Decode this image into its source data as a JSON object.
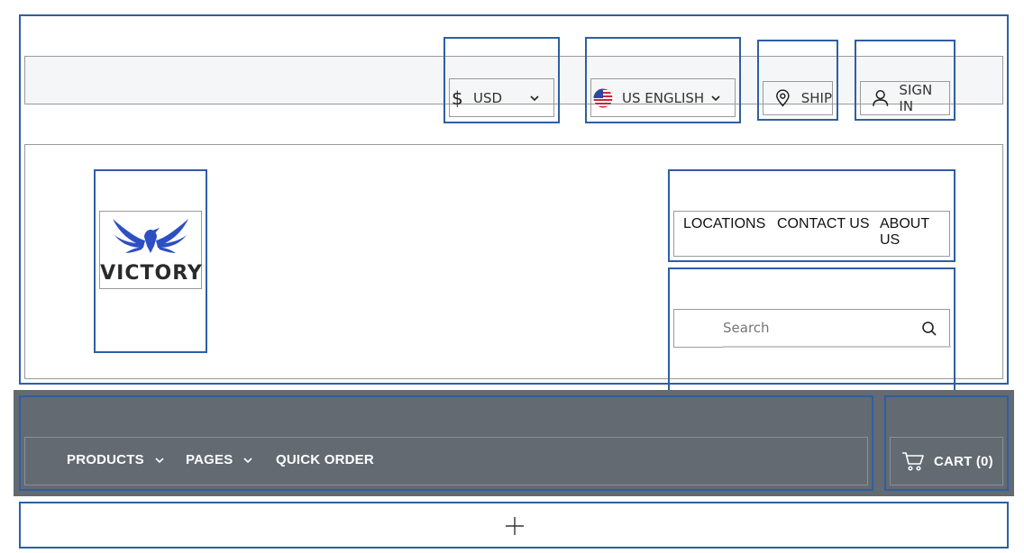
{
  "header": {
    "utility_bar": {
      "currency": {
        "symbol": "$",
        "label": "USD",
        "icon": "chevron-down-icon"
      },
      "language": {
        "label": "US ENGLISH",
        "flag_icon": "us-flag-icon",
        "icon": "chevron-down-icon"
      },
      "ship": {
        "label": "SHIP",
        "icon": "location-pin-icon"
      },
      "sign_in": {
        "label": "SIGN IN",
        "icon": "user-icon"
      }
    },
    "logo": {
      "text": "VICTORY",
      "icon": "eagle-icon",
      "color": "#2e4fc4"
    },
    "top_nav": {
      "items": [
        "LOCATIONS",
        "CONTACT US",
        "ABOUT US"
      ]
    },
    "search": {
      "placeholder": "Search",
      "icon": "search-icon"
    }
  },
  "main_nav": {
    "background": "#636a72",
    "items": [
      {
        "label": "PRODUCTS",
        "has_dropdown": true
      },
      {
        "label": "PAGES",
        "has_dropdown": true
      },
      {
        "label": "QUICK ORDER",
        "has_dropdown": false
      }
    ],
    "cart": {
      "label": "CART (0)",
      "icon": "cart-icon"
    }
  },
  "add_section": {
    "icon": "plus-icon"
  },
  "colors": {
    "outline": "#2e5fa3",
    "utility_bg": "#f5f6f7"
  }
}
